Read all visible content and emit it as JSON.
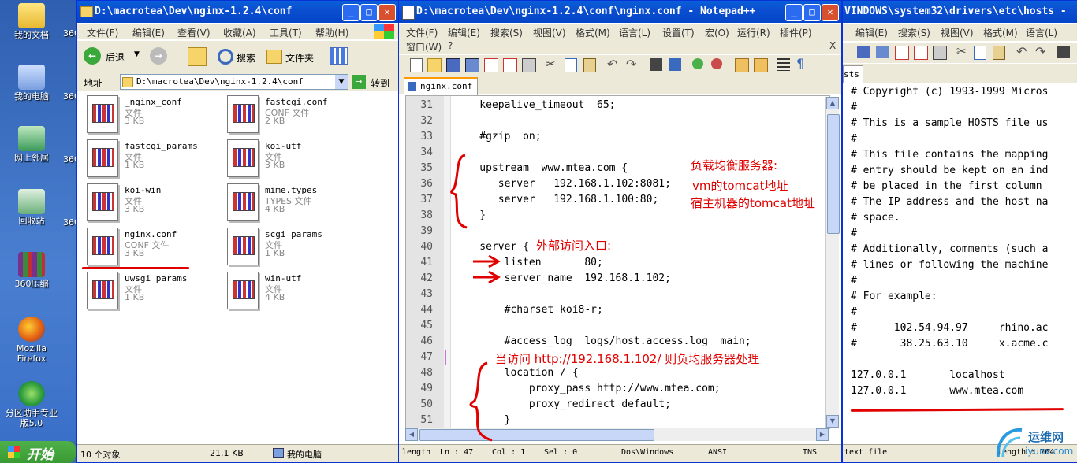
{
  "desktop": {
    "icons": [
      {
        "label": "我的文档",
        "side": "360"
      },
      {
        "label": "我的电脑",
        "side": "360"
      },
      {
        "label": "网上邻居",
        "side": "360"
      },
      {
        "label": "回收站",
        "side": "360"
      },
      {
        "label": "360压缩",
        "side": ""
      },
      {
        "label": "Mozilla Firefox",
        "side": ""
      },
      {
        "label": "分区助手专业版5.0",
        "side": ""
      }
    ],
    "start_label": "开始"
  },
  "explorer": {
    "title": "D:\\macrotea\\Dev\\nginx-1.2.4\\conf",
    "menu": [
      "文件(F)",
      "编辑(E)",
      "查看(V)",
      "收藏(A)",
      "工具(T)",
      "帮助(H)"
    ],
    "back_label": "后退",
    "search_label": "搜索",
    "folders_label": "文件夹",
    "address_label": "地址",
    "address_value": "D:\\macrotea\\Dev\\nginx-1.2.4\\conf",
    "go_label": "转到",
    "files": [
      {
        "name": "_nginx_conf",
        "type": "文件",
        "size": "3 KB"
      },
      {
        "name": "fastcgi.conf",
        "type": "CONF 文件",
        "size": "2 KB"
      },
      {
        "name": "fastcgi_params",
        "type": "文件",
        "size": "1 KB"
      },
      {
        "name": "koi-utf",
        "type": "文件",
        "size": "3 KB"
      },
      {
        "name": "koi-win",
        "type": "文件",
        "size": "3 KB"
      },
      {
        "name": "mime.types",
        "type": "TYPES 文件",
        "size": "4 KB"
      },
      {
        "name": "nginx.conf",
        "type": "CONF 文件",
        "size": "3 KB"
      },
      {
        "name": "scgi_params",
        "type": "文件",
        "size": "1 KB"
      },
      {
        "name": "uwsgi_params",
        "type": "文件",
        "size": "1 KB"
      },
      {
        "name": "win-utf",
        "type": "文件",
        "size": "4 KB"
      }
    ],
    "status": {
      "count": "10 个对象",
      "size": "21.1 KB",
      "location": "我的电脑"
    }
  },
  "notepad": {
    "title": "D:\\macrotea\\Dev\\nginx-1.2.4\\conf\\nginx.conf - Notepad++",
    "menu1": [
      "文件(F)",
      "编辑(E)",
      "搜索(S)",
      "视图(V)",
      "格式(M)",
      "语言(L)",
      "设置(T)",
      "宏(O)",
      "运行(R)",
      "插件(P)"
    ],
    "menu2": [
      "窗口(W)",
      "?"
    ],
    "close_x": "X",
    "tab": "nginx.conf",
    "lines": [
      {
        "n": "31",
        "t": "    keepalive_timeout  65;"
      },
      {
        "n": "32",
        "t": ""
      },
      {
        "n": "33",
        "t": "    #gzip  on;"
      },
      {
        "n": "34",
        "t": ""
      },
      {
        "n": "35",
        "t": "    upstream  www.mtea.com {"
      },
      {
        "n": "36",
        "t": "       server   192.168.1.102:8081;"
      },
      {
        "n": "37",
        "t": "       server   192.168.1.100:80;"
      },
      {
        "n": "38",
        "t": "    }"
      },
      {
        "n": "39",
        "t": ""
      },
      {
        "n": "40",
        "t": "    server {"
      },
      {
        "n": "41",
        "t": "        listen       80;"
      },
      {
        "n": "42",
        "t": "        server_name  192.168.1.102;"
      },
      {
        "n": "43",
        "t": ""
      },
      {
        "n": "44",
        "t": "        #charset koi8-r;"
      },
      {
        "n": "45",
        "t": ""
      },
      {
        "n": "46",
        "t": "        #access_log  logs/host.access.log  main;"
      },
      {
        "n": "47",
        "t": ""
      },
      {
        "n": "48",
        "t": "        location / {"
      },
      {
        "n": "49",
        "t": "            proxy_pass http://www.mtea.com;"
      },
      {
        "n": "50",
        "t": "            proxy_redirect default;"
      },
      {
        "n": "51",
        "t": "        }"
      }
    ],
    "annotations": {
      "lb_title": "负载均衡服务器:",
      "lb_vm": "vm的tomcat地址",
      "lb_host": "宿主机器的tomcat地址",
      "entry": "外部访问入口:",
      "access": "当访问 http://192.168.1.102/ 则负均服务器处理"
    },
    "status": {
      "length": "length",
      "ln": "Ln : 47",
      "col": "Col : 1",
      "sel": "Sel : 0",
      "eol": "Dos\\Windows",
      "enc": "ANSI",
      "ins": "INS"
    }
  },
  "hosts_win": {
    "title": "VINDOWS\\system32\\drivers\\etc\\hosts -",
    "menu": [
      "编辑(E)",
      "搜索(S)",
      "视图(V)",
      "格式(M)",
      "语言(L)"
    ],
    "tab": "sts",
    "lines": [
      "# Copyright (c) 1993-1999 Micros",
      "#",
      "# This is a sample HOSTS file us",
      "#",
      "# This file contains the mapping",
      "# entry should be kept on an ind",
      "# be placed in the first column",
      "# The IP address and the host na",
      "# space.",
      "#",
      "# Additionally, comments (such a",
      "# lines or following the machine",
      "#",
      "# For example:",
      "#",
      "#      102.54.94.97     rhino.ac",
      "#       38.25.63.10     x.acme.c",
      "",
      "127.0.0.1       localhost",
      "127.0.0.1       www.mtea.com"
    ],
    "status": {
      "type": "text file",
      "length": "length : 764"
    }
  },
  "watermark": {
    "cn": "运维网",
    "url": "iyunv.com"
  }
}
